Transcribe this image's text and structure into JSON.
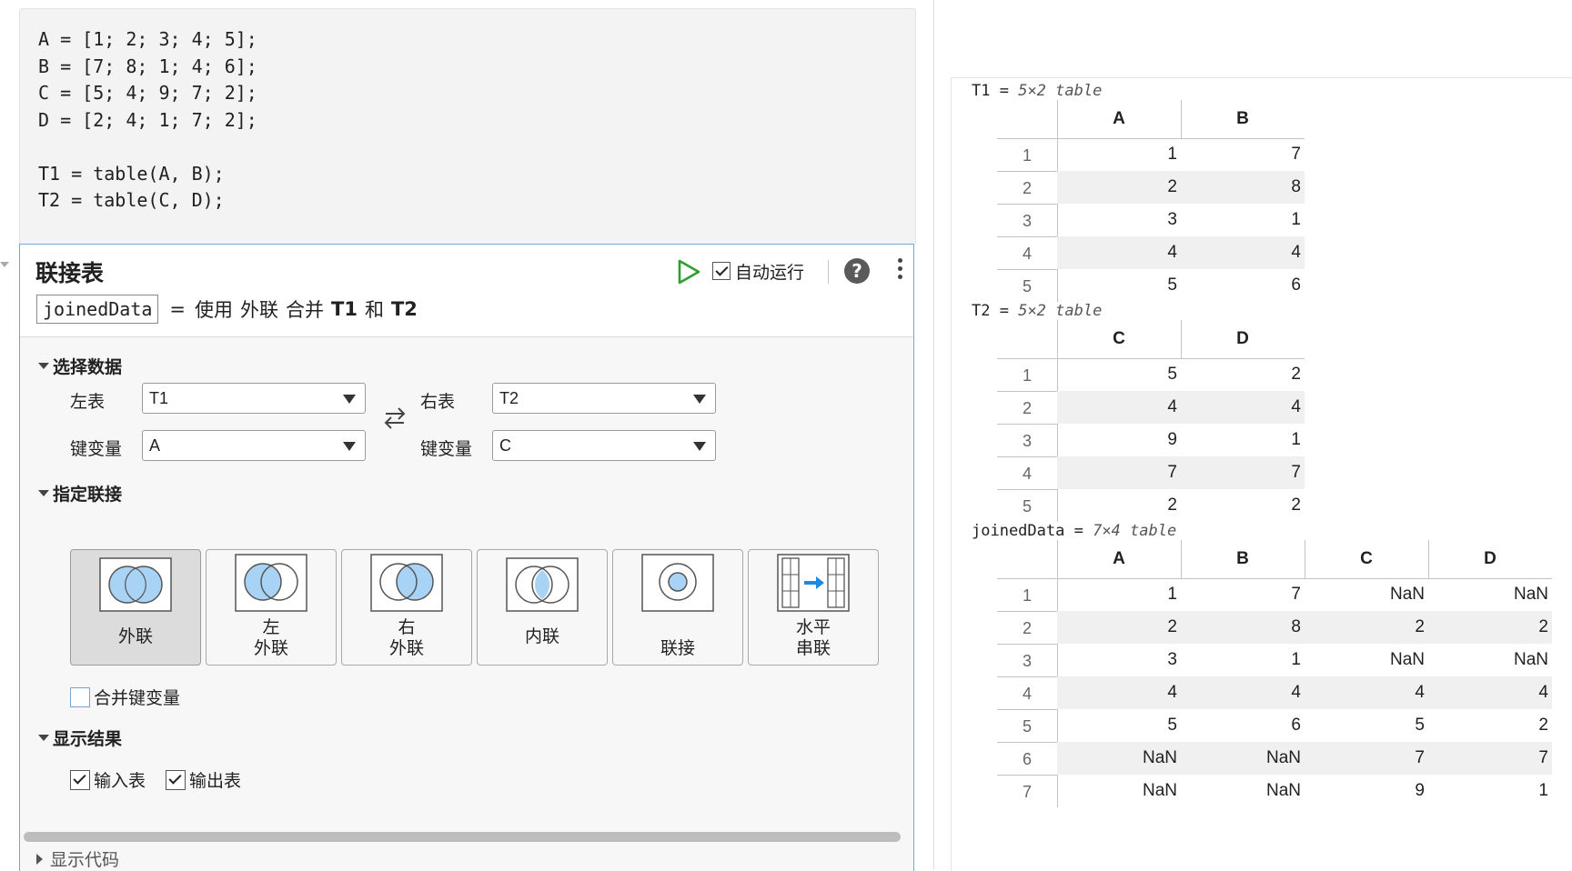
{
  "code": {
    "lines": [
      "A = [1; 2; 3; 4; 5];",
      "B = [7; 8; 1; 4; 6];",
      "C = [5; 4; 9; 7; 2];",
      "D = [2; 4; 1; 7; 2];",
      "",
      "T1 = table(A, B);",
      "T2 = table(C, D);"
    ]
  },
  "task": {
    "title": "联接表",
    "autorun_label": "自动运行",
    "autorun_checked": true,
    "help_label": "?",
    "summary": {
      "output_var": "joinedData",
      "equals": "=",
      "prefix": "使用",
      "join_type": "外联",
      "merge": "合并",
      "left_name": "T1",
      "and": "和",
      "right_name": "T2"
    },
    "select_data": {
      "header": "选择数据",
      "left_table_label": "左表",
      "left_table_value": "T1",
      "right_table_label": "右表",
      "right_table_value": "T2",
      "left_key_label": "键变量",
      "left_key_value": "A",
      "right_key_label": "键变量",
      "right_key_value": "C"
    },
    "join": {
      "header": "指定联接",
      "options": [
        {
          "line1": "外联",
          "line2": "",
          "icon": "outer-join-icon",
          "selected": true
        },
        {
          "line1": "左",
          "line2": "外联",
          "icon": "left-outer-join-icon",
          "selected": false
        },
        {
          "line1": "右",
          "line2": "外联",
          "icon": "right-outer-join-icon",
          "selected": false
        },
        {
          "line1": "内联",
          "line2": "",
          "icon": "inner-join-icon",
          "selected": false
        },
        {
          "line1": "联接",
          "line2": "",
          "icon": "join-icon",
          "selected": false
        },
        {
          "line1": "水平",
          "line2": "串联",
          "icon": "horizontal-concat-icon",
          "selected": false
        }
      ],
      "merge_keys_label": "合并键变量",
      "merge_keys_checked": false
    },
    "display": {
      "header": "显示结果",
      "input_label": "输入表",
      "input_checked": true,
      "output_label": "输出表",
      "output_checked": true
    },
    "show_code_label": "显示代码"
  },
  "output": {
    "tables": [
      {
        "name": "T1",
        "eq": " = ",
        "size": "5×2 table",
        "columns": [
          "A",
          "B"
        ],
        "rows": [
          [
            "1",
            "7"
          ],
          [
            "2",
            "8"
          ],
          [
            "3",
            "1"
          ],
          [
            "4",
            "4"
          ],
          [
            "5",
            "6"
          ]
        ]
      },
      {
        "name": "T2",
        "eq": " = ",
        "size": "5×2 table",
        "columns": [
          "C",
          "D"
        ],
        "rows": [
          [
            "5",
            "2"
          ],
          [
            "4",
            "4"
          ],
          [
            "9",
            "1"
          ],
          [
            "7",
            "7"
          ],
          [
            "2",
            "2"
          ]
        ]
      },
      {
        "name": "joinedData",
        "eq": " = ",
        "size": "7×4 table",
        "columns": [
          "A",
          "B",
          "C",
          "D"
        ],
        "rows": [
          [
            "1",
            "7",
            "NaN",
            "NaN"
          ],
          [
            "2",
            "8",
            "2",
            "2"
          ],
          [
            "3",
            "1",
            "NaN",
            "NaN"
          ],
          [
            "4",
            "4",
            "4",
            "4"
          ],
          [
            "5",
            "6",
            "5",
            "2"
          ],
          [
            "NaN",
            "NaN",
            "7",
            "7"
          ],
          [
            "NaN",
            "NaN",
            "9",
            "1"
          ]
        ]
      }
    ]
  },
  "colors": {
    "accent_border": "#76a7d9",
    "run_green": "#2ca02c",
    "venn_fill": "#a9d3f5",
    "venn_stroke": "#555555"
  }
}
